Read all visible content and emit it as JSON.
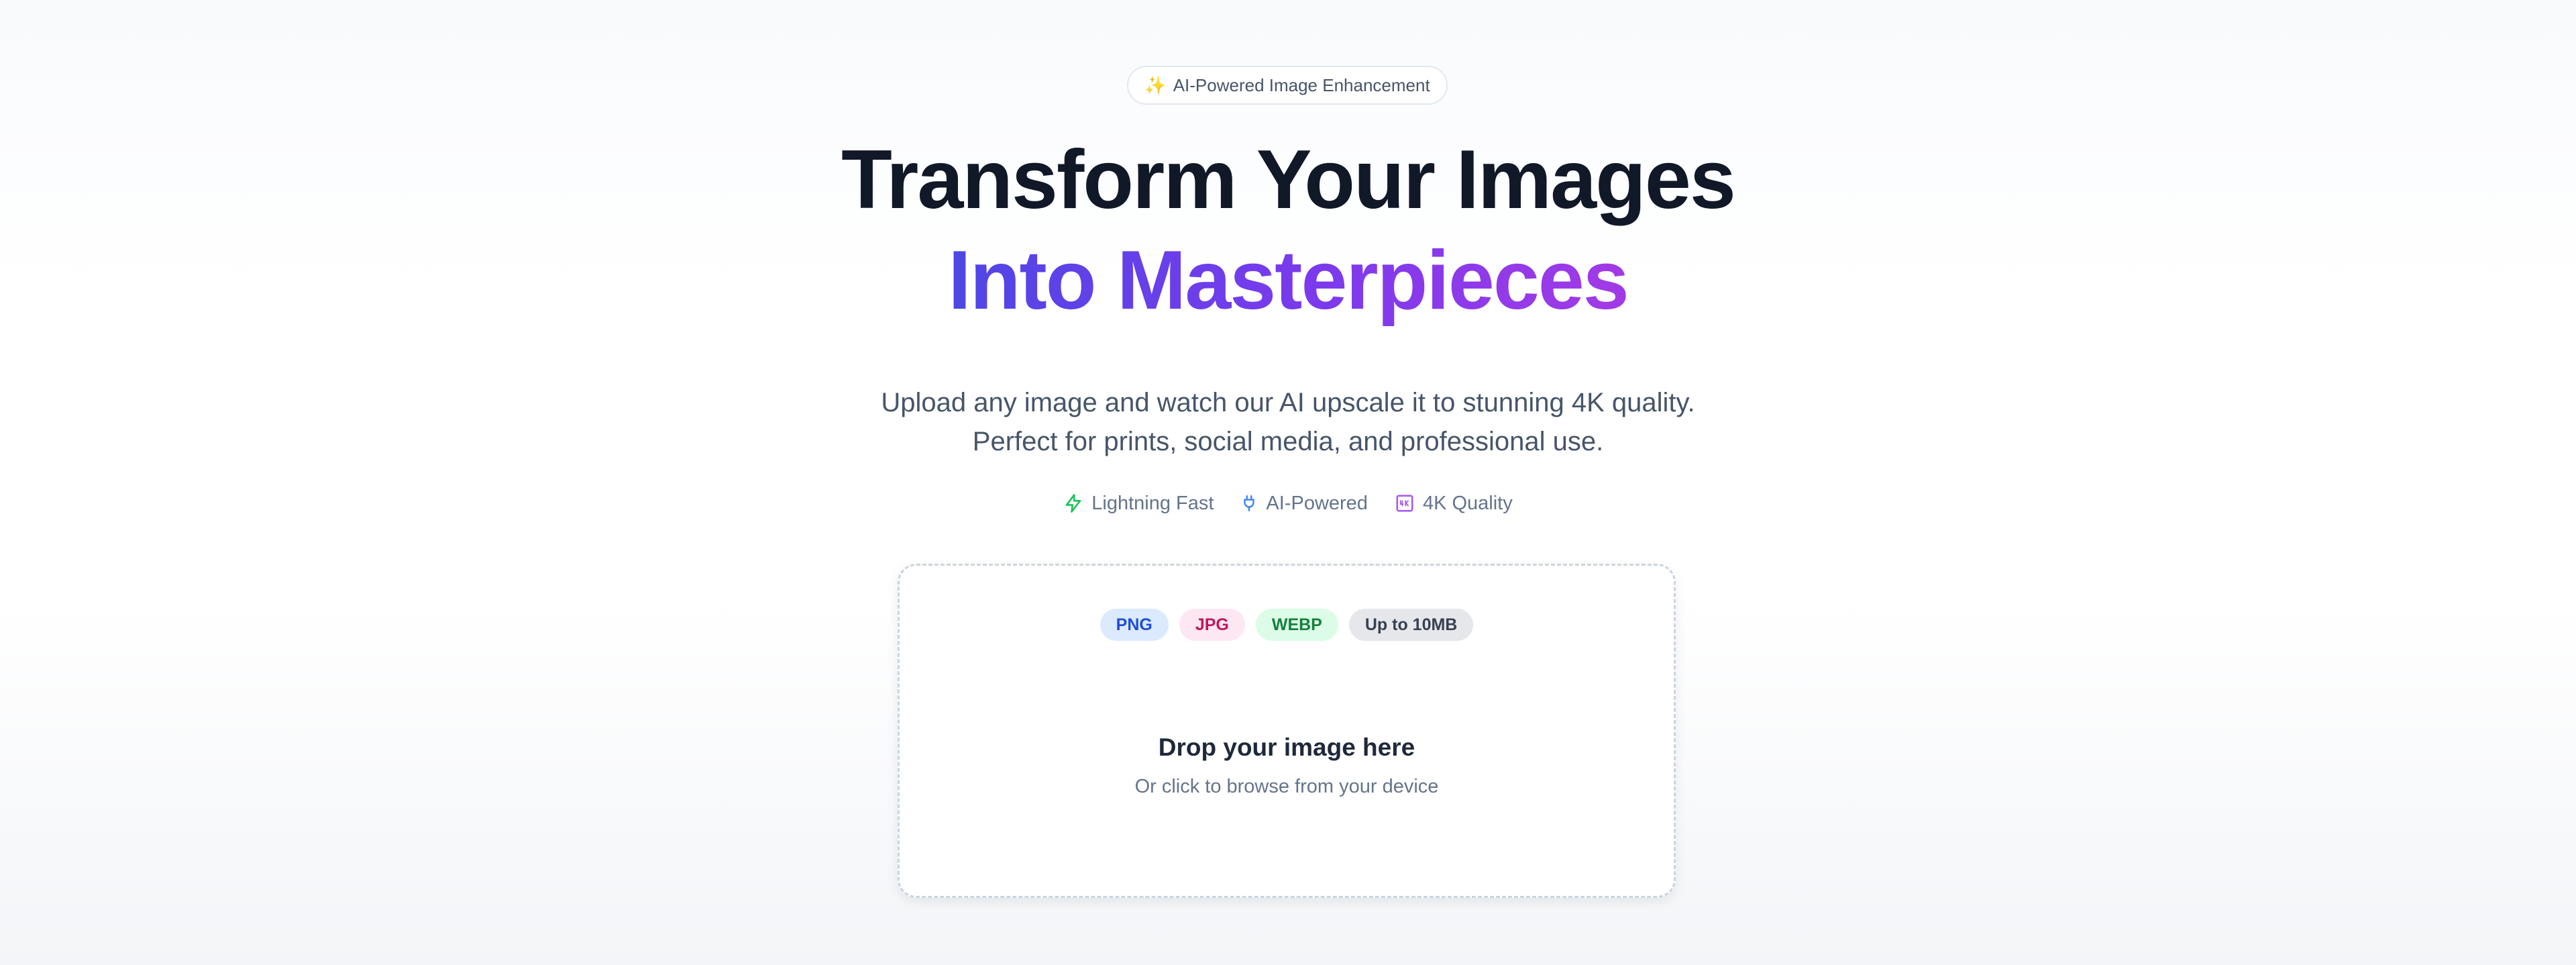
{
  "badge": {
    "icon": "sparkles-icon",
    "label": "AI-Powered Image Enhancement"
  },
  "hero": {
    "title_line1": "Transform Your Images",
    "title_line2": "Into Masterpieces",
    "subtitle_line1": "Upload any image and watch our AI upscale it to stunning 4K quality.",
    "subtitle_line2": "Perfect for prints, social media, and professional use."
  },
  "features": [
    {
      "icon": "lightning-icon",
      "label": "Lightning Fast",
      "color": "#22c55e"
    },
    {
      "icon": "plug-icon",
      "label": "AI-Powered",
      "color": "#3b82f6"
    },
    {
      "icon": "4k-icon",
      "label": "4K Quality",
      "color": "#a855f7"
    }
  ],
  "dropzone": {
    "tags": [
      {
        "label": "PNG",
        "bg": "#dbeafe",
        "color": "#1d4ed8"
      },
      {
        "label": "JPG",
        "bg": "#fce7f3",
        "color": "#be185d"
      },
      {
        "label": "WEBP",
        "bg": "#dcfce7",
        "color": "#15803d"
      },
      {
        "label": "Up to 10MB",
        "bg": "#e5e7eb",
        "color": "#374151"
      }
    ],
    "title": "Drop your image here",
    "subtitle": "Or click to browse from your device"
  },
  "colors": {
    "accent_start": "#4f46e5",
    "accent_end": "#a23ae6",
    "heading": "#111827",
    "muted": "#64748b"
  }
}
